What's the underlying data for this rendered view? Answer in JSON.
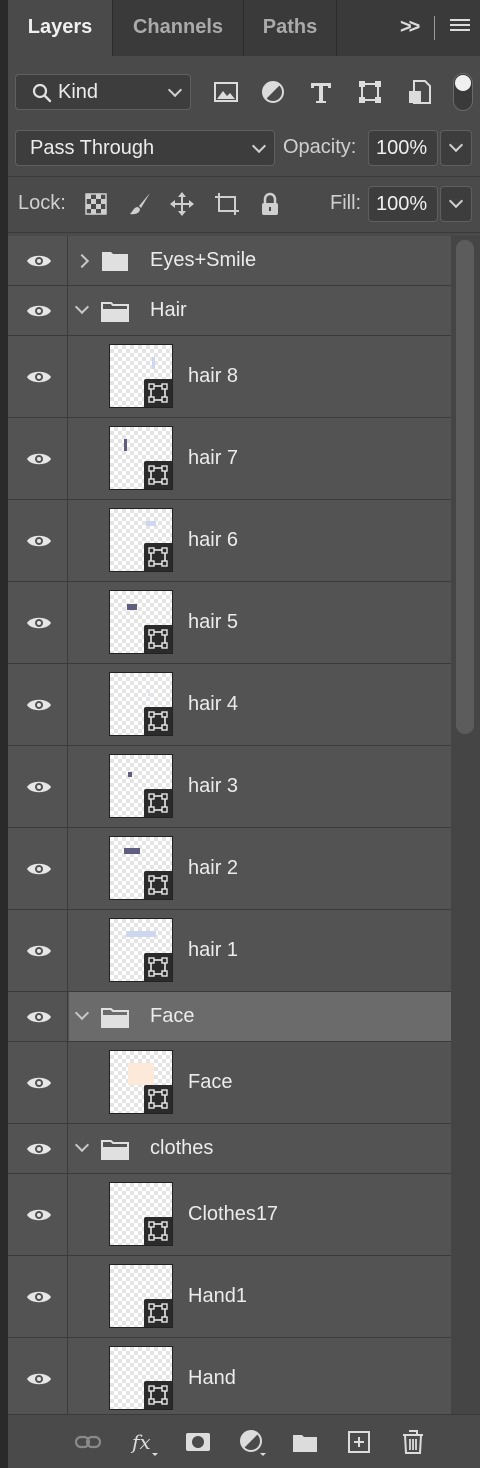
{
  "tabs": [
    {
      "label": "Layers",
      "active": true
    },
    {
      "label": "Channels",
      "active": false
    },
    {
      "label": "Paths",
      "active": false
    }
  ],
  "tab_controls": {
    "collapse_glyph": ">>"
  },
  "filter": {
    "kind_label": "Kind"
  },
  "blend": {
    "mode": "Pass Through",
    "opacity_label": "Opacity:",
    "opacity_value": "100%"
  },
  "lock": {
    "label": "Lock:",
    "fill_label": "Fill:",
    "fill_value": "100%"
  },
  "layers": [
    {
      "name": "Eyes+Smile",
      "kind": "group",
      "expanded": false,
      "visible": true
    },
    {
      "name": "Hair",
      "kind": "group",
      "expanded": true,
      "visible": true
    },
    {
      "name": "hair 8",
      "kind": "smart",
      "visible": true,
      "thumb_color": "#cdd8f0"
    },
    {
      "name": "hair 7",
      "kind": "smart",
      "visible": true,
      "thumb_color": "#5f5d80"
    },
    {
      "name": "hair 6",
      "kind": "smart",
      "visible": true,
      "thumb_color": "#cdd8f0"
    },
    {
      "name": "hair 5",
      "kind": "smart",
      "visible": true,
      "thumb_color": "#5f5d80"
    },
    {
      "name": "hair 4",
      "kind": "smart",
      "visible": true,
      "thumb_color": "#dfe6f5"
    },
    {
      "name": "hair 3",
      "kind": "smart",
      "visible": true,
      "thumb_color": "#5f5d80"
    },
    {
      "name": "hair 2",
      "kind": "smart",
      "visible": true,
      "thumb_color": "#5f5d80"
    },
    {
      "name": "hair 1",
      "kind": "smart",
      "visible": true,
      "thumb_color": "#cdd8f0"
    },
    {
      "name": "Face",
      "kind": "group",
      "expanded": true,
      "visible": true,
      "selected": true
    },
    {
      "name": "Face",
      "kind": "smart",
      "visible": true,
      "thumb_color": "#fde9d9"
    },
    {
      "name": "clothes",
      "kind": "group",
      "expanded": true,
      "visible": true
    },
    {
      "name": "Clothes17",
      "kind": "smart",
      "visible": true,
      "thumb_color": ""
    },
    {
      "name": "Hand1",
      "kind": "smart",
      "visible": true,
      "thumb_color": ""
    },
    {
      "name": "Hand",
      "kind": "smart",
      "visible": true,
      "thumb_color": ""
    }
  ],
  "colors": {
    "panel_bg": "#4a4a4a",
    "row_bg": "#535353",
    "selected_row": "#6b6b6b",
    "text": "#ececec"
  },
  "icons": {
    "filter": [
      "image-filter-icon",
      "adjustment-filter-icon",
      "type-filter-icon",
      "shape-filter-icon",
      "smart-object-filter-icon"
    ],
    "lock": [
      "lock-transparent-pixels-icon",
      "lock-image-pixels-icon",
      "lock-position-icon",
      "lock-artboard-icon",
      "lock-all-icon"
    ],
    "bottom": [
      "link-layers-icon",
      "fx-icon",
      "add-mask-icon",
      "adjustment-layer-icon",
      "new-group-icon",
      "new-layer-icon",
      "delete-layer-icon"
    ]
  }
}
